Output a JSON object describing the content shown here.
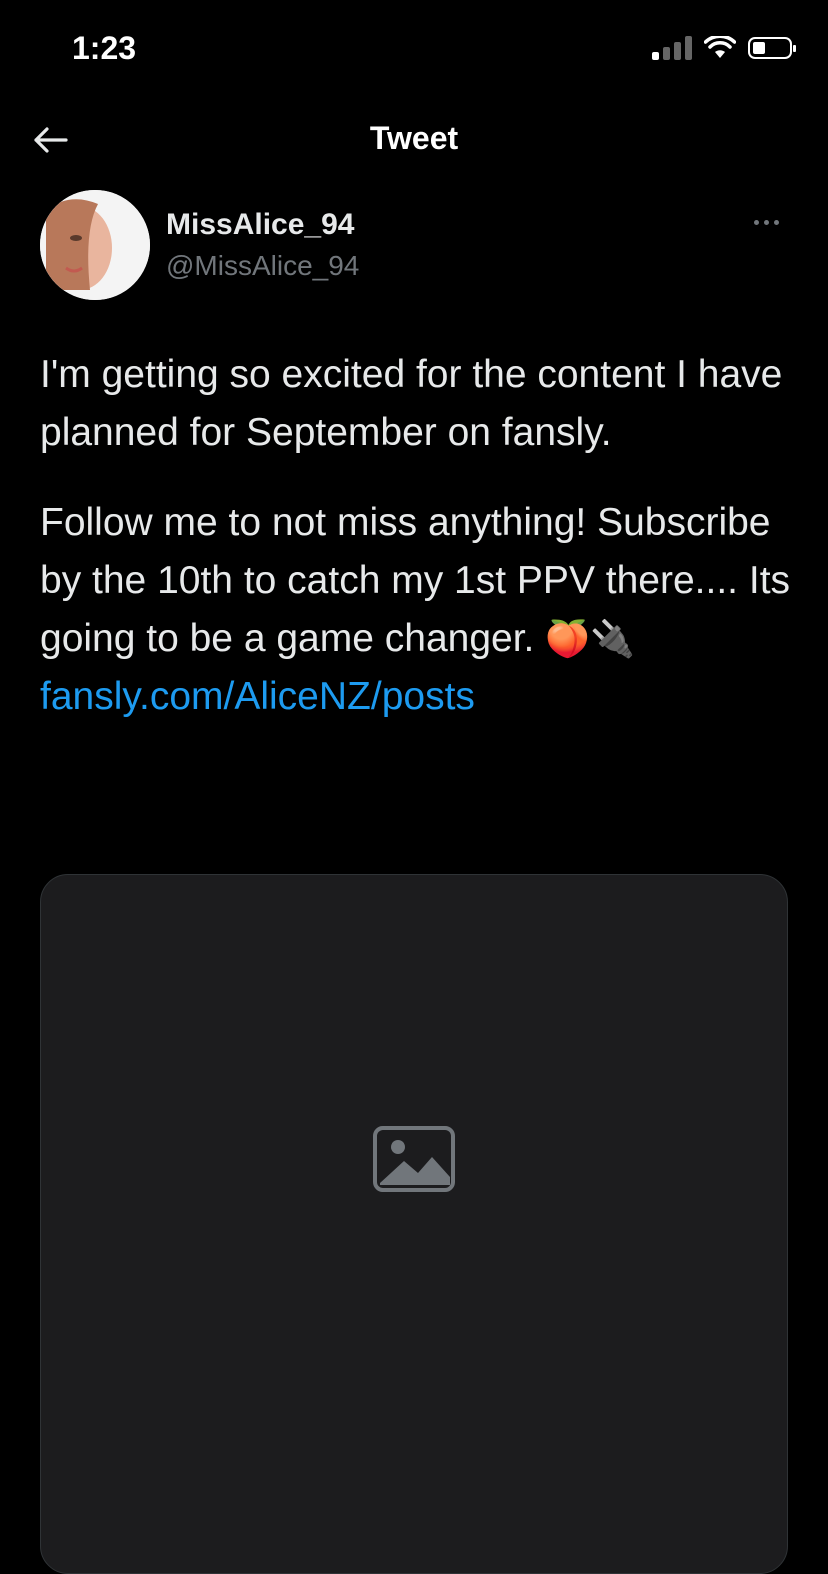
{
  "status_bar": {
    "time": "1:23",
    "icons": [
      "signal-icon",
      "wifi-icon",
      "battery-icon"
    ]
  },
  "header": {
    "title": "Tweet",
    "back_icon": "arrow-left-icon"
  },
  "author": {
    "display_name": "MissAlice_94",
    "handle": "@MissAlice_94",
    "more_icon": "more-horizontal-icon"
  },
  "tweet": {
    "paragraph_1": "I'm getting so excited for the content I have planned for September on fansly.",
    "paragraph_2": "Follow me to not miss anything! Subscribe by the 10th to catch my 1st PPV there.... Its going to be a game changer.",
    "emojis": "🍑🔌",
    "link": "fansly.com/AliceNZ/posts"
  },
  "media": {
    "icon": "image-icon"
  },
  "colors": {
    "background": "#000000",
    "text": "#e7e9ea",
    "secondary_text": "#71767b",
    "link": "#1d9bf0"
  }
}
